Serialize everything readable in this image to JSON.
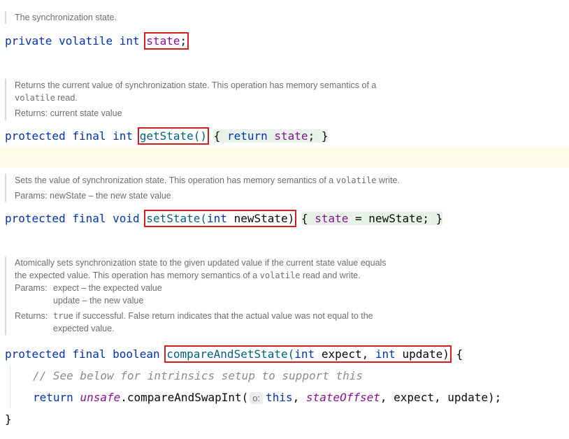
{
  "blocks": {
    "state": {
      "doc": "The synchronization state.",
      "code": {
        "mod1": "private",
        "mod2": "volatile",
        "type": "int",
        "name": "state",
        "semi": ";"
      }
    },
    "getState": {
      "doc_line1": "Returns the current value of synchronization state. This operation has memory semantics of a",
      "doc_code": "volatile",
      "doc_line2_tail": " read.",
      "returns_label": "Returns:",
      "returns_text": "current state value",
      "code": {
        "mod1": "protected",
        "mod2": "final",
        "type": "int",
        "name": "getState()",
        "open": "{",
        "kw_return": "return",
        "field": "state",
        "semi": ";",
        "close": "}"
      }
    },
    "setState": {
      "doc_pre": "Sets the value of synchronization state. This operation has memory semantics of a ",
      "doc_code": "volatile",
      "doc_post": " write.",
      "params_label": "Params:",
      "params_text": "newState – the new state value",
      "code": {
        "mod1": "protected",
        "mod2": "final",
        "type": "void",
        "name": "setState(",
        "ptype": "int",
        "pname": "newState)",
        "open": "{",
        "field": "state",
        "eq": "=",
        "val": "newState;",
        "close": "}"
      }
    },
    "cas": {
      "doc_line1": "Atomically sets synchronization state to the given updated value if the current state value equals",
      "doc_line2_pre": "the expected value. This operation has memory semantics of a ",
      "doc_code": "volatile",
      "doc_line2_post": " read and write.",
      "params_label": "Params:",
      "param1": "expect – the expected value",
      "param2": "update – the new value",
      "returns_label": "Returns:",
      "returns_code": "true",
      "returns_line1": " if successful. False return indicates that the actual value was not equal to the",
      "returns_line2": "expected value.",
      "code": {
        "mod1": "protected",
        "mod2": "final",
        "type": "boolean",
        "name": "compareAndSetState(",
        "p1type": "int",
        "p1name": "expect,",
        "p2type": "int",
        "p2name": "update)",
        "open": "{",
        "comment": "// See below for intrinsics setup to support this",
        "kw_return": "return",
        "unsafe": "unsafe",
        "call": ".compareAndSwapInt(",
        "hint": "o:",
        "kw_this": "this",
        "comma1": ",",
        "offset": "stateOffset",
        "rest": ", expect, update);",
        "close": "}"
      }
    }
  }
}
